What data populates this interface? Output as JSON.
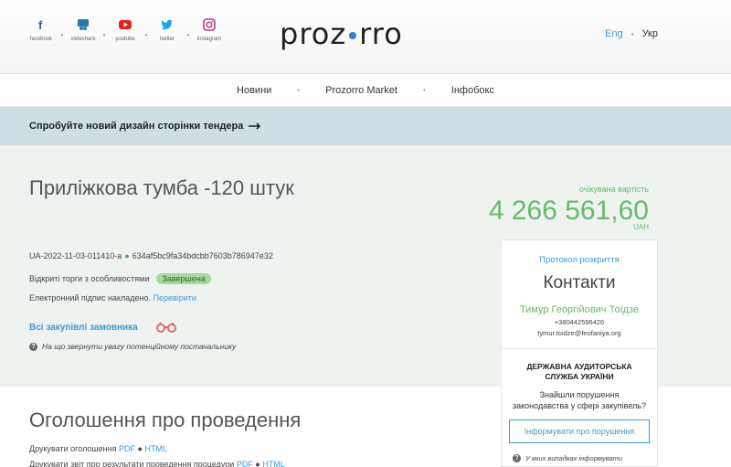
{
  "header": {
    "socials": [
      {
        "label": "facebook",
        "icon": "facebook-icon",
        "color": "#3b5998"
      },
      {
        "label": "slideshare",
        "icon": "slideshare-icon",
        "color": "#2a7ab0"
      },
      {
        "label": "youtube",
        "icon": "youtube-icon",
        "color": "#e62117"
      },
      {
        "label": "twitter",
        "icon": "twitter-icon",
        "color": "#1da1f2"
      },
      {
        "label": "instagram",
        "icon": "instagram-icon",
        "color": "#c13584"
      }
    ],
    "logo_left": "proz",
    "logo_right": "rro",
    "lang_en": "Eng",
    "lang_ua": "Укр"
  },
  "nav": {
    "items": [
      "Новини",
      "Prozorro Market",
      "Інфобокс"
    ]
  },
  "banner": {
    "text": "Спробуйте новий дизайн сторінки тендера"
  },
  "tender": {
    "title": "Приліжкова тумба -120 штук",
    "id": "UA-2022-11-03-011410-a",
    "hash": "634af5bc9fa34bdcbb7603b786947e32",
    "procedure": "Відкриті торги з особливостями",
    "status": "Завершена",
    "signature_text": "Електронний підпис накладено.",
    "signature_link": "Перевірити",
    "all_purchases": "Всі закупівлі замовника",
    "hint": "На що звернути увагу потенційному постачальнику",
    "value_label": "очікувана вартість",
    "value_amount": "4 266 561,60",
    "value_currency": "UAH"
  },
  "card": {
    "protocol": "Протокол розкриття",
    "contacts_title": "Контакти",
    "person": "Тимур Георгійович Тоїдзе",
    "phone": "+380442596426",
    "email": "tymur.toidze@feofaniya.org",
    "audit_title": "ДЕРЖАВНА АУДИТОРСЬКА СЛУЖБА УКРАЇНИ",
    "found_text": "Знайшли порушення законодавства у сфері закупівель?",
    "report_button": "Інформувати про порушення",
    "cases_text": "У яких випадках інформувати"
  },
  "announcement": {
    "title": "Оголошення про проведення",
    "print1_text": "Друкувати оголошення",
    "print2_text": "Друкувати звіт про результати проведення процедури",
    "pdf": "PDF",
    "html": "HTML"
  }
}
